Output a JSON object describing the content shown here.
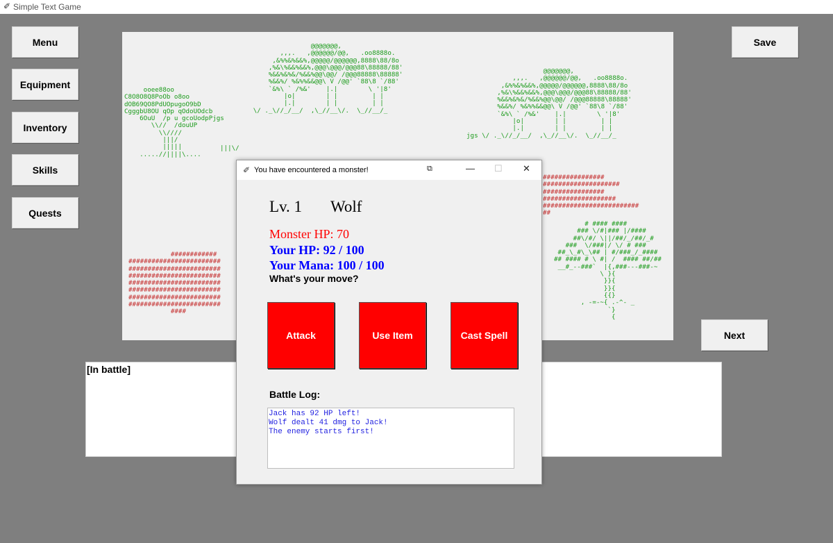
{
  "app": {
    "title": "Simple Text Game"
  },
  "sidebar": [
    {
      "label": "Menu"
    },
    {
      "label": "Equipment"
    },
    {
      "label": "Inventory"
    },
    {
      "label": "Skills"
    },
    {
      "label": "Quests"
    }
  ],
  "save_label": "Save",
  "next_label": "Next",
  "scene": {
    "tree_left_canopy": "                      @@@@@@@,\n              ,,,.   ,@@@@@@/@@,   .oo8888o.\n            ,&%%&%&&%,@@@@@/@@@@@@,8888\\88/8o\n           ,%&\\%&&%&&%,@@@\\@@@/@@@88\\88888/88'\n           %&&%&%&/%&&%@@\\@@/ /@@@88888\\88888'\n           %&&%/ %&%%&&@@\\ V /@@' `88\\8 `/88'\n           `&%\\ ` /%&'    |.|        \\ '|8'\n               |o|        | |         | |\n               |.|        | |         | |\n       \\/ ._\\//_/__/  ,\\_//__\\/.  \\_//__/_",
    "tree_left_small": "     ooee88oo\nC8O8O8Q8PoOb o8oo\ndOB69QO8PdUOpugoO9bD\nCgggbU8OU qOp qOdoUOdcb\n    6OuU  /p u gcoUodpPjgs\n       \\\\//  /douUP\n         \\\\////\n          |||/\n          |||||\n    .....//||||\\....",
    "tree_left_tail": "|||\\/",
    "tree_right": "                    @@@@@@@,\n            ,,,.   ,@@@@@@/@@,   .oo8888o.\n         ,&%%&%&&%,@@@@@/@@@@@@,8888\\88/8o\n        ,%&\\%&&%&&%,@@@\\@@@/@@@88\\88888/88'\n        %&&%&%&/%&&%@@\\@@/ /@@@88888\\88888'\n        %&&%/ %&%%&&@@\\ V /@@' `88\\8 `/88'\n        `&%\\ ` /%&'    |.|        \\ '|8'\n            |o|        | |         | |\n            |.|        | |         | |\njgs \\/ ._\\//_/__/  ,\\_//__\\/.  \\_//__/_",
    "red_left": "           ############\n########################\n########################\n########################\n########################\n########################\n########################\n########################\n           ####",
    "red_right": "################\n####################\n################\n###################\n#########################\n##",
    "tree_palm": "        # #### ####\n      ### \\/#|### |/####\n     ##\\/#/ \\||/##/_/##/_#\n   ###  \\/###|/ \\/ # ###\n ##_\\_#\\_\\## | #/###_/_####\n## #### # \\ #| /  #### ##/##\n __#_--###`  |{,###---###-~\n            \\ }{\n             }}{\n             }}{\n             {{}\n       , -=-~{ .-^- _\n              `}\n               {"
  },
  "textbox": {
    "text": "[In battle]"
  },
  "dialog": {
    "title": "You have encountered a monster!",
    "level": "Lv. 1",
    "monster_name": "Wolf",
    "monster_hp": "Monster HP: 70",
    "your_hp": "Your HP: 92 / 100",
    "your_mana": "Your Mana: 100 / 100",
    "prompt": "What's your move?",
    "actions": [
      {
        "label": "Attack"
      },
      {
        "label": "Use Item"
      },
      {
        "label": "Cast Spell"
      }
    ],
    "battle_log_label": "Battle Log:",
    "battle_log": [
      "Jack has 92 HP left!",
      "Wolf dealt 41 dmg to Jack!",
      "The enemy starts first!"
    ]
  },
  "colors": {
    "action_button": "#ff0000",
    "monster_hp": "#ff0000",
    "player_stats": "#0000ff",
    "log_text": "#2222e0",
    "tree_green": "#1a9a1a",
    "hash_red": "#c42a2a"
  }
}
